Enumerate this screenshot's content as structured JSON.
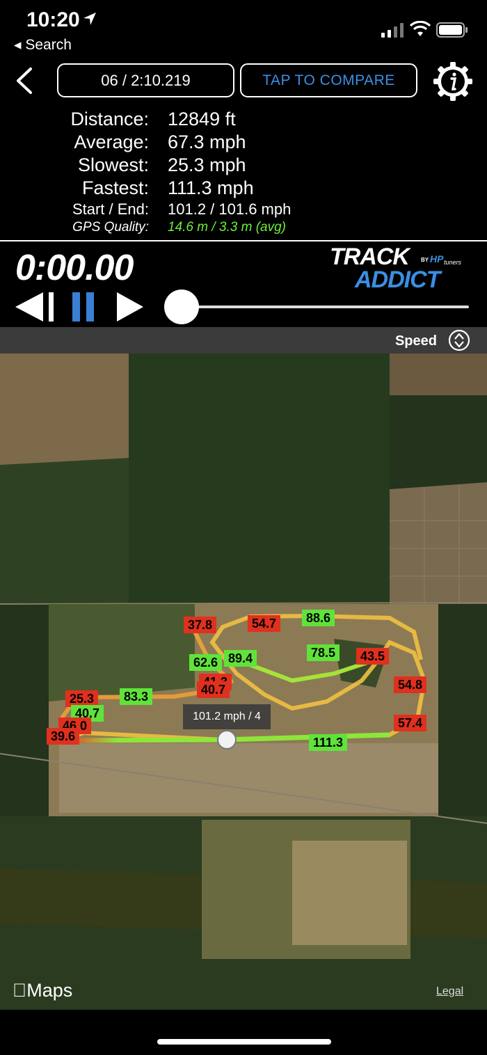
{
  "status_bar": {
    "time": "10:20",
    "back_app": "◂ Search",
    "location_icon": "location-arrow-icon",
    "signal_icon": "cellular-signal-icon",
    "wifi_icon": "wifi-icon",
    "battery_icon": "battery-icon"
  },
  "header": {
    "back_icon": "chevron-left-icon",
    "lap_label": "06 / 2:10.219",
    "compare_label": "TAP TO COMPARE",
    "info_icon": "info-gear-icon",
    "compare_color": "#3a8fe4"
  },
  "stats": {
    "distance": {
      "label": "Distance:",
      "value": "12849 ft"
    },
    "average": {
      "label": "Average:",
      "value": "67.3 mph"
    },
    "slowest": {
      "label": "Slowest:",
      "value": "25.3 mph"
    },
    "fastest": {
      "label": "Fastest:",
      "value": "111.3 mph"
    },
    "start_end": {
      "label": "Start / End:",
      "value": "101.2 / 101.6 mph"
    },
    "gps": {
      "label": "GPS Quality:",
      "value": "14.6 m / 3.3 m (avg)",
      "color": "#6df03a"
    }
  },
  "player": {
    "timer": "0:00.00",
    "logo_top": "TRACK",
    "logo_by": "BY",
    "logo_brand": "HP",
    "logo_brand_sub": "tuners",
    "logo_bottom": "ADDICT",
    "progress": 0.0
  },
  "mode": {
    "label": "Speed",
    "selector_icon": "up-down-selector-icon"
  },
  "map": {
    "tooltip": "101.2 mph / 4",
    "maps_brand": "Maps",
    "legal": "Legal",
    "slow_color": "#e0301e",
    "fast_color": "#5fe33a",
    "labels": [
      {
        "text": "37.8",
        "kind": "slow"
      },
      {
        "text": "54.7",
        "kind": "slow"
      },
      {
        "text": "88.6",
        "kind": "fast"
      },
      {
        "text": "62.6",
        "kind": "fast"
      },
      {
        "text": "89.4",
        "kind": "fast"
      },
      {
        "text": "78.5",
        "kind": "fast"
      },
      {
        "text": "43.5",
        "kind": "slow"
      },
      {
        "text": "41.3",
        "kind": "slow"
      },
      {
        "text": "40.7",
        "kind": "slow"
      },
      {
        "text": "25.3",
        "kind": "slow"
      },
      {
        "text": "83.3",
        "kind": "fast"
      },
      {
        "text": "40.7",
        "kind": "fast"
      },
      {
        "text": "46.0",
        "kind": "slow"
      },
      {
        "text": "39.6",
        "kind": "slow"
      },
      {
        "text": "54.8",
        "kind": "slow"
      },
      {
        "text": "57.4",
        "kind": "slow"
      },
      {
        "text": "111.3",
        "kind": "fast"
      }
    ]
  }
}
